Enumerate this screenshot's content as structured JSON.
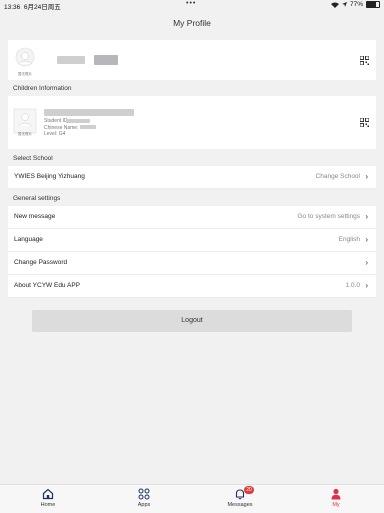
{
  "status": {
    "time": "13:36",
    "date": "6月24日周五",
    "battery": "77%",
    "battery_level": 0.77,
    "more": "•••"
  },
  "header": {
    "title": "My Profile"
  },
  "profile": {
    "avatar_caption": "暂无照片"
  },
  "children": {
    "section_title": "Children Information",
    "avatar_caption": "暂无照片",
    "student_id_label": "Student ID:",
    "chinese_name_label": "Chinese Name:",
    "level_label": "Level: G4"
  },
  "school": {
    "section_title": "Select School",
    "current": "YWIES Beijing Yizhuang",
    "action": "Change School"
  },
  "settings": {
    "section_title": "General settings",
    "items": [
      {
        "label": "New message",
        "value": "Go to system settings"
      },
      {
        "label": "Language",
        "value": "English"
      },
      {
        "label": "Change Password",
        "value": ""
      },
      {
        "label": "About YCYW Edu APP",
        "value": "1.0.0"
      }
    ]
  },
  "logout_label": "Logout",
  "tabbar": {
    "tabs": [
      {
        "label": "Home",
        "icon": "home-icon"
      },
      {
        "label": "Apps",
        "icon": "apps-icon"
      },
      {
        "label": "Messages",
        "icon": "bell-icon",
        "badge": "20"
      },
      {
        "label": "My",
        "icon": "person-icon"
      }
    ]
  },
  "colors": {
    "accent": "#e0304a",
    "badge": "#e03b3b",
    "background": "#f1f1f2"
  }
}
